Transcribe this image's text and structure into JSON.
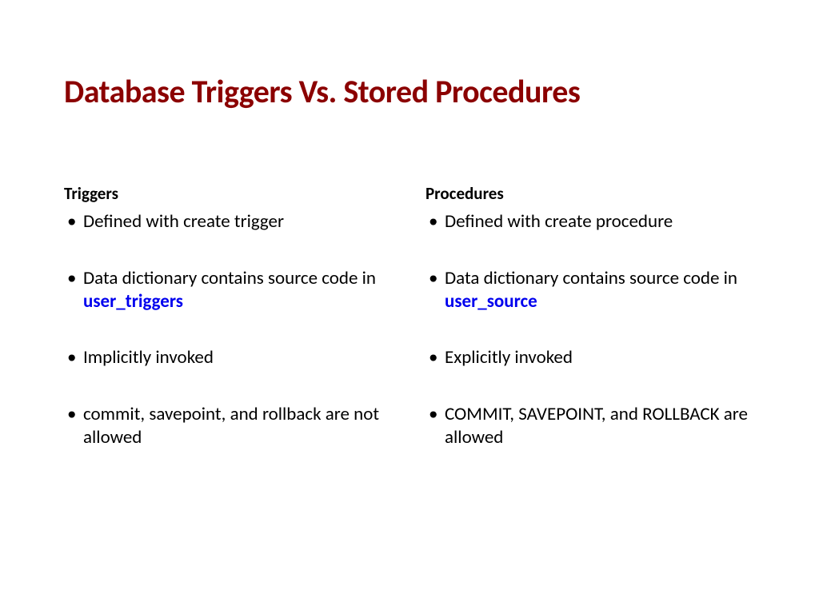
{
  "title": "Database Triggers Vs. Stored Procedures",
  "left": {
    "heading": "Triggers",
    "items": [
      {
        "text": "Defined with create trigger"
      },
      {
        "text_prefix": "Data dictionary contains source code in ",
        "keyword": "user_triggers"
      },
      {
        "text": "Implicitly invoked"
      },
      {
        "text": "commit, savepoint, and rollback are not allowed"
      }
    ]
  },
  "right": {
    "heading": "Procedures",
    "items": [
      {
        "text": " Defined with create procedure"
      },
      {
        "text_prefix": "Data dictionary contains source code in ",
        "keyword": "user_source"
      },
      {
        "text": "Explicitly invoked"
      },
      {
        "text": "COMMIT, SAVEPOINT, and ROLLBACK are allowed"
      }
    ]
  }
}
